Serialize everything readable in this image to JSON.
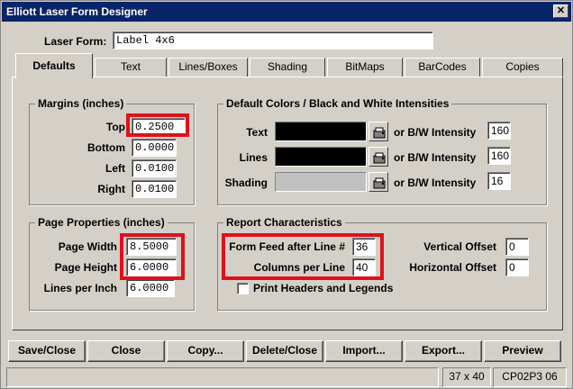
{
  "window": {
    "title": "Elliott Laser Form Designer",
    "close_glyph": "✕"
  },
  "form": {
    "label": "Laser Form:",
    "value": "Label 4x6"
  },
  "tabs": [
    {
      "label": "Defaults",
      "active": true
    },
    {
      "label": "Text"
    },
    {
      "label": "Lines/Boxes"
    },
    {
      "label": "Shading"
    },
    {
      "label": "BitMaps"
    },
    {
      "label": "BarCodes"
    },
    {
      "label": "Copies"
    }
  ],
  "margins": {
    "title": "Margins (inches)",
    "top_label": "Top",
    "top_value": "0.2500",
    "bottom_label": "Bottom",
    "bottom_value": "0.0000",
    "left_label": "Left",
    "left_value": "0.0100",
    "right_label": "Right",
    "right_value": "0.0100"
  },
  "colors": {
    "title": "Default Colors / Black and White Intensities",
    "bw_label": "or B/W Intensity",
    "rows": [
      {
        "label": "Text",
        "swatch": "#000000",
        "intensity": "160"
      },
      {
        "label": "Lines",
        "swatch": "#000000",
        "intensity": "160"
      },
      {
        "label": "Shading",
        "swatch": "#c0c0c0",
        "intensity": "16"
      }
    ]
  },
  "page": {
    "title": "Page Properties (inches)",
    "width_label": "Page Width",
    "width_value": "8.5000",
    "height_label": "Page Height",
    "height_value": "6.0000",
    "lpi_label": "Lines per Inch",
    "lpi_value": "6.0000"
  },
  "report": {
    "title": "Report Characteristics",
    "formfeed_label": "Form Feed after Line #",
    "formfeed_value": "36",
    "columns_label": "Columns per Line",
    "columns_value": "40",
    "voffset_label": "Vertical Offset",
    "voffset_value": "0",
    "hoffset_label": "Horizontal Offset",
    "hoffset_value": "0",
    "print_headers_label": "Print Headers and Legends",
    "print_headers_checked": false
  },
  "buttons": {
    "save_close": "Save/Close",
    "close": "Close",
    "copy": "Copy...",
    "delete_close": "Delete/Close",
    "import": "Import...",
    "export": "Export...",
    "preview": "Preview"
  },
  "status": {
    "main": "",
    "size": "37 x 40",
    "code": "CP02P3 06"
  },
  "colors_theme": {
    "highlight": "#e0101a",
    "titlebar": "#0a246a",
    "face": "#d4d0c8"
  }
}
